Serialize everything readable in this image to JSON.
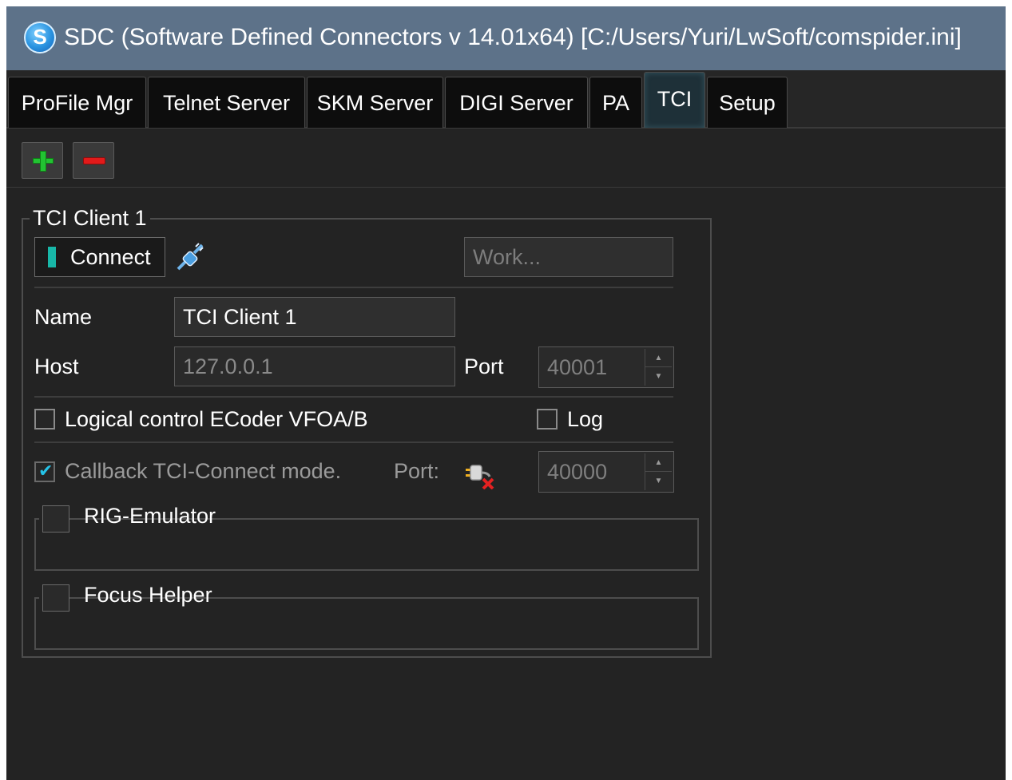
{
  "window": {
    "app_icon_glyph": "S",
    "title": "SDC (Software Defined Connectors v 14.01x64) [C:/Users/Yuri/LwSoft/comspider.ini]"
  },
  "tabs": [
    {
      "label": "ProFile Mgr",
      "active": false
    },
    {
      "label": "Telnet Server",
      "active": false
    },
    {
      "label": "SKM Server",
      "active": false
    },
    {
      "label": "DIGI Server",
      "active": false
    },
    {
      "label": "PA",
      "active": false
    },
    {
      "label": "TCI",
      "active": true
    },
    {
      "label": "Setup",
      "active": false
    }
  ],
  "toolbar": {
    "add_icon": "plus-icon",
    "remove_icon": "minus-icon",
    "add_color": "#22c332",
    "remove_color": "#e21a1a"
  },
  "client": {
    "group_title": "TCI Client 1",
    "connect_label": "Connect",
    "connect_led_color": "#18b7a8",
    "link_icon": "link-icon",
    "status_placeholder": "Work...",
    "name_label": "Name",
    "name_value": "TCI Client 1",
    "host_label": "Host",
    "host_value": "127.0.0.1",
    "port_label": "Port",
    "port_value": "40001",
    "logical_control_label": "Logical control ECoder VFOA/B",
    "logical_control_checked": false,
    "log_label": "Log",
    "log_checked": false,
    "callback_label": "Callback TCI-Connect mode.",
    "callback_checked": true,
    "callback_port_label": "Port:",
    "callback_port_icon": "plug-disconnected-icon",
    "callback_port_value": "40000",
    "rig_emulator_label": "RIG-Emulator",
    "rig_emulator_checked": false,
    "focus_helper_label": "Focus Helper",
    "focus_helper_checked": false
  },
  "colors": {
    "titlebar": "#5d7289",
    "background": "#232323",
    "accent_check": "#25c3e8"
  }
}
